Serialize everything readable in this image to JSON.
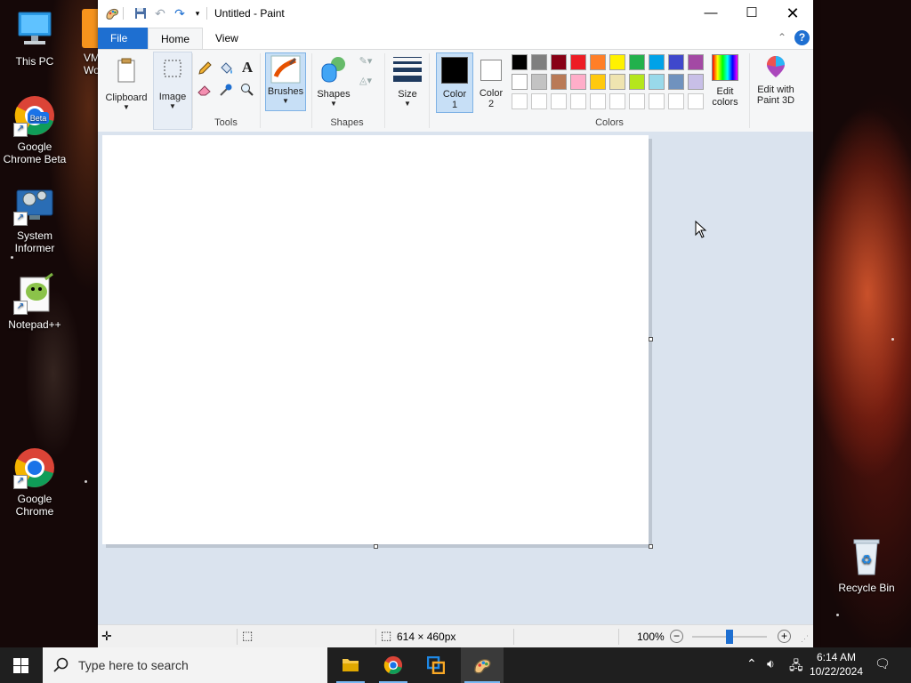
{
  "desktop": {
    "icons": [
      {
        "name": "this-pc",
        "label": "This PC"
      },
      {
        "name": "google-chrome-beta",
        "label": "Google Chrome Beta"
      },
      {
        "name": "system-informer",
        "label": "System Informer"
      },
      {
        "name": "notepad-plus-plus",
        "label": "Notepad++"
      },
      {
        "name": "google-chrome",
        "label": "Google Chrome"
      },
      {
        "name": "recycle-bin",
        "label": "Recycle Bin"
      },
      {
        "name": "vmware-partial",
        "label": "VM\nWor"
      }
    ]
  },
  "window": {
    "title": "Untitled - Paint",
    "tabs": {
      "file": "File",
      "home": "Home",
      "view": "View"
    },
    "ribbon": {
      "clipboard": "Clipboard",
      "image": "Image",
      "tools_group": "Tools",
      "brushes": "Brushes",
      "shapes_button": "Shapes",
      "shapes_group": "Shapes",
      "size": "Size",
      "color1_line1": "Color",
      "color1_line2": "1",
      "color2_line1": "Color",
      "color2_line2": "2",
      "colors_group": "Colors",
      "edit_colors_line1": "Edit",
      "edit_colors_line2": "colors",
      "paint3d_line1": "Edit with",
      "paint3d_line2": "Paint 3D"
    },
    "colors": {
      "color1": "#000000",
      "color2": "#ffffff",
      "palette_row1": [
        "#000000",
        "#7f7f7f",
        "#880015",
        "#ed1c24",
        "#ff7f27",
        "#fff200",
        "#22b14c",
        "#00a2e8",
        "#3f48cc",
        "#a349a4"
      ],
      "palette_row2": [
        "#ffffff",
        "#c3c3c3",
        "#b97a57",
        "#ffaec9",
        "#ffc90e",
        "#efe4b0",
        "#b5e61d",
        "#99d9ea",
        "#7092be",
        "#c8bfe7"
      ],
      "accent": "#1e6fd1"
    },
    "status": {
      "canvas_size": "614 × 460px",
      "zoom": "100%"
    }
  },
  "taskbar": {
    "search_placeholder": "Type here to search",
    "time": "6:14 AM",
    "date": "10/22/2024"
  }
}
